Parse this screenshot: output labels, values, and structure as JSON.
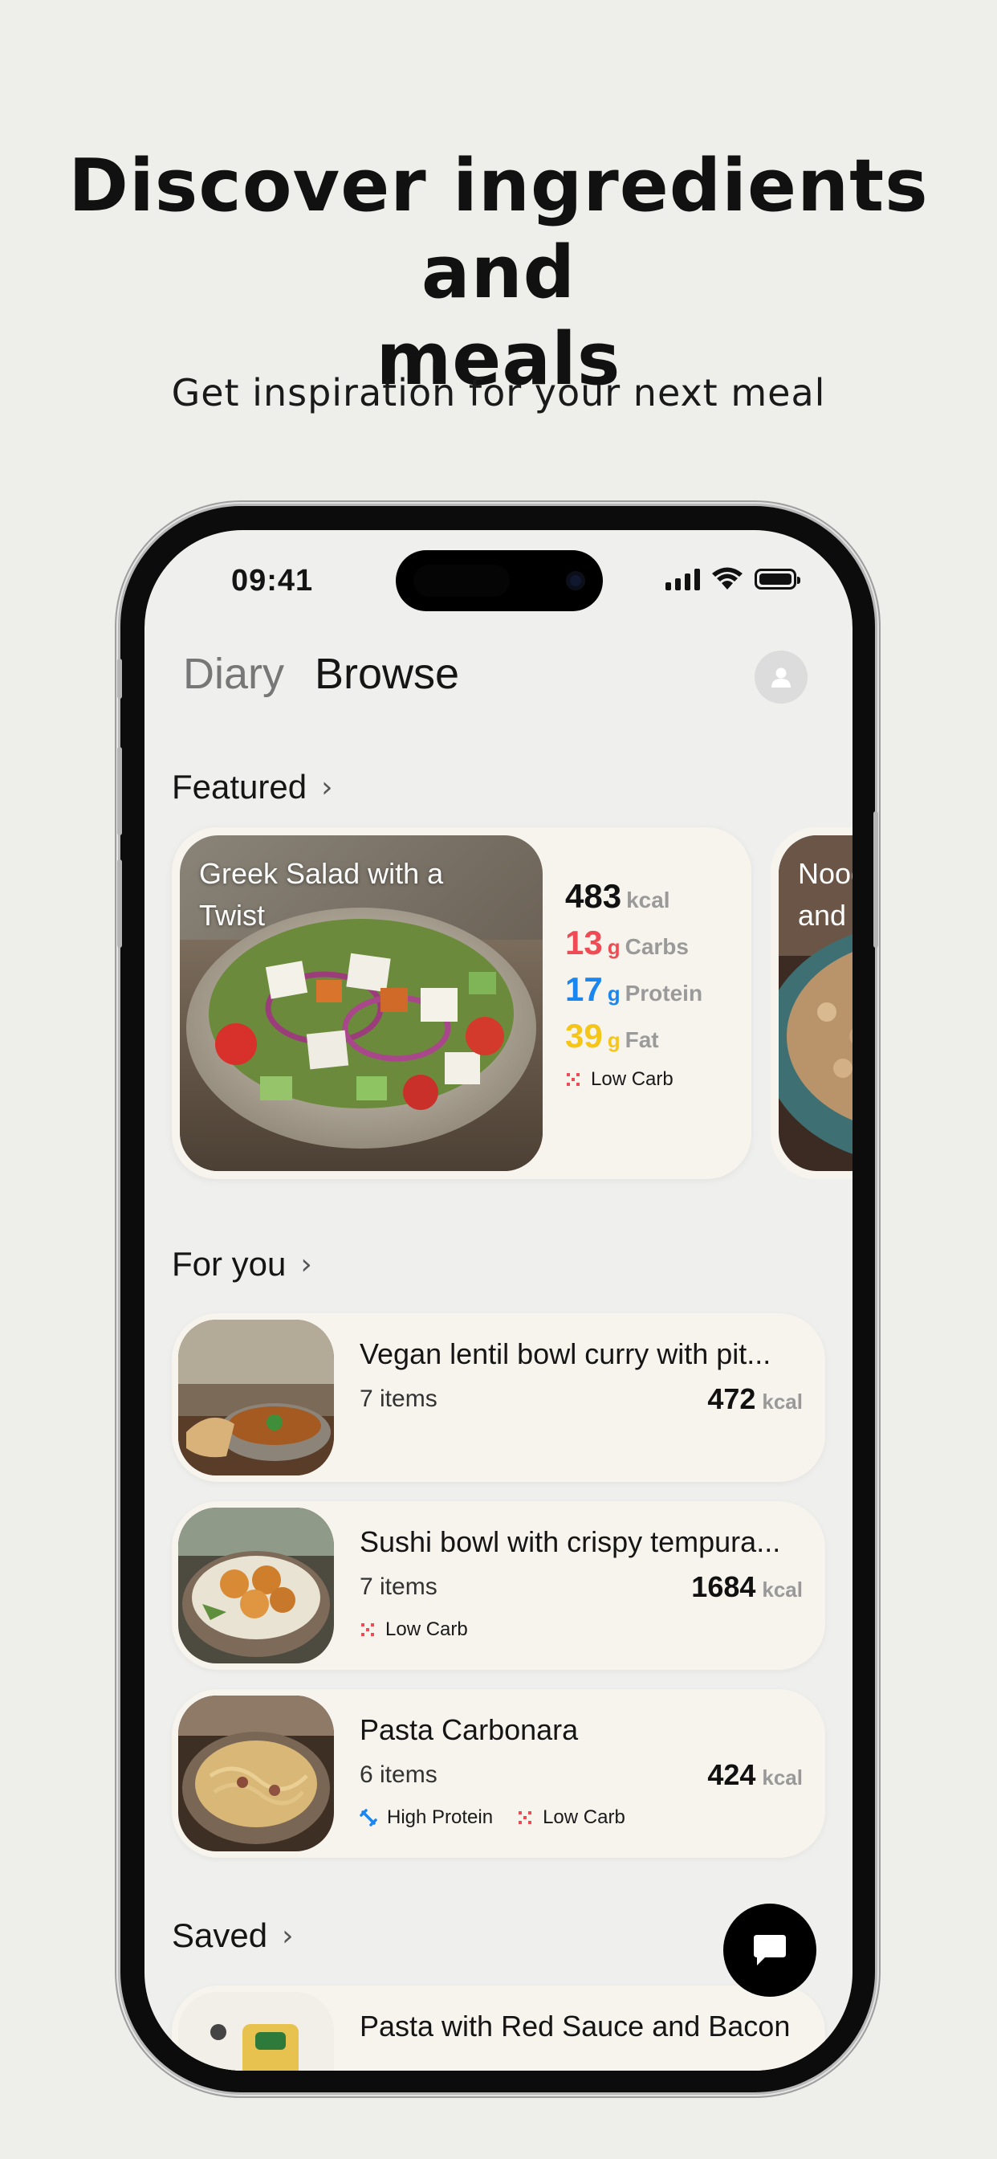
{
  "hero": {
    "title_line1": "Discover ingredients and",
    "title_line2": "meals",
    "subtitle": "Get inspiration for your next meal"
  },
  "status_bar": {
    "time": "09:41"
  },
  "tabs": [
    {
      "label": "Diary",
      "active": false
    },
    {
      "label": "Browse",
      "active": true
    }
  ],
  "featured": {
    "heading": "Featured",
    "card": {
      "title": "Greek Salad with a Twist",
      "kcal": "483",
      "kcal_unit": "kcal",
      "carbs": "13",
      "carbs_unit": "g",
      "carbs_label": "Carbs",
      "protein": "17",
      "protein_unit": "g",
      "protein_label": "Protein",
      "fat": "39",
      "fat_unit": "g",
      "fat_label": "Fat",
      "tag": "Low Carb"
    },
    "next_card_title": "Nood\nand"
  },
  "for_you": {
    "heading": "For you",
    "items": [
      {
        "name": "Vegan lentil bowl curry with pit...",
        "items": "7 items",
        "kcal": "472",
        "unit": "kcal",
        "tags": []
      },
      {
        "name": "Sushi bowl with crispy tempura...",
        "items": "7 items",
        "kcal": "1684",
        "unit": "kcal",
        "tags": [
          "Low Carb"
        ]
      },
      {
        "name": "Pasta Carbonara",
        "items": "6 items",
        "kcal": "424",
        "unit": "kcal",
        "tags": [
          "High Protein",
          "Low Carb"
        ]
      }
    ]
  },
  "saved": {
    "heading": "Saved",
    "items": [
      {
        "name": "Pasta with Red Sauce and Bacon"
      }
    ]
  },
  "colors": {
    "carbs": "#ef4b55",
    "protein": "#1a86f0",
    "fat": "#f5c518",
    "page_bg": "#eeeeea",
    "card_bg": "#f7f4ee"
  },
  "icons": {
    "low_carb": "low-carb-icon",
    "high_protein": "high-protein-icon",
    "chat": "chat-icon",
    "profile": "profile-icon"
  }
}
